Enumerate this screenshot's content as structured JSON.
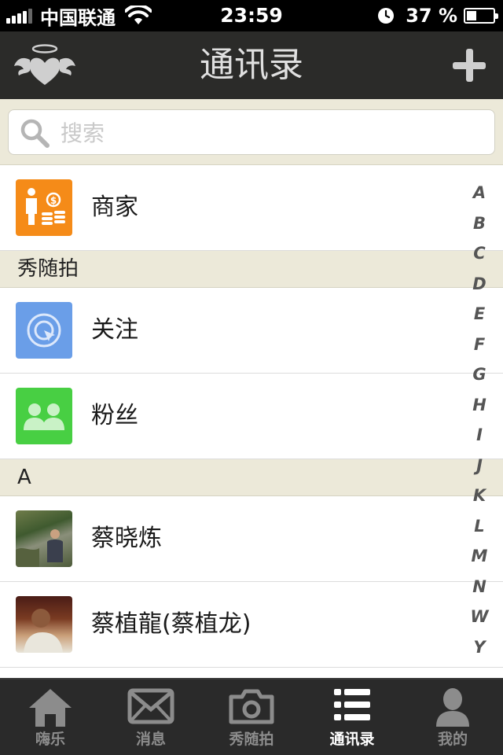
{
  "status_bar": {
    "carrier": "中国联通",
    "time": "23:59",
    "battery_percent_text": "37 %",
    "battery_level": 0.37,
    "signal_bars": 4,
    "icons": [
      "signal-icon",
      "wifi-icon",
      "clock-icon",
      "battery-icon"
    ]
  },
  "nav": {
    "title": "通讯录",
    "left_icon": "winged-heart-logo-icon",
    "right_icon": "plus-icon"
  },
  "search": {
    "placeholder": "搜索",
    "value": ""
  },
  "rows": {
    "merchant": "商家",
    "follow": "关注",
    "fans": "粉丝",
    "contact1": "蔡晓炼",
    "contact2": "蔡植龍(蔡植龙)"
  },
  "sections": {
    "xiusuipai": "秀随拍",
    "a": "A"
  },
  "alpha_index": [
    "A",
    "B",
    "C",
    "D",
    "E",
    "F",
    "G",
    "H",
    "I",
    "J",
    "K",
    "L",
    "M",
    "N",
    "W",
    "Y"
  ],
  "tabs": [
    {
      "label": "嗨乐",
      "icon": "home-icon",
      "active": false
    },
    {
      "label": "消息",
      "icon": "mail-icon",
      "active": false
    },
    {
      "label": "秀随拍",
      "icon": "camera-icon",
      "active": false
    },
    {
      "label": "通讯录",
      "icon": "list-icon",
      "active": true
    },
    {
      "label": "我的",
      "icon": "person-icon",
      "active": false
    }
  ],
  "colors": {
    "nav_bg": "#2b2b29",
    "section_bg": "#ece9d9",
    "merchant_tile": "#f58b18",
    "follow_tile": "#6a9ee8",
    "fans_tile": "#48cf43",
    "tabbar_bg": "#2a2a2a"
  }
}
